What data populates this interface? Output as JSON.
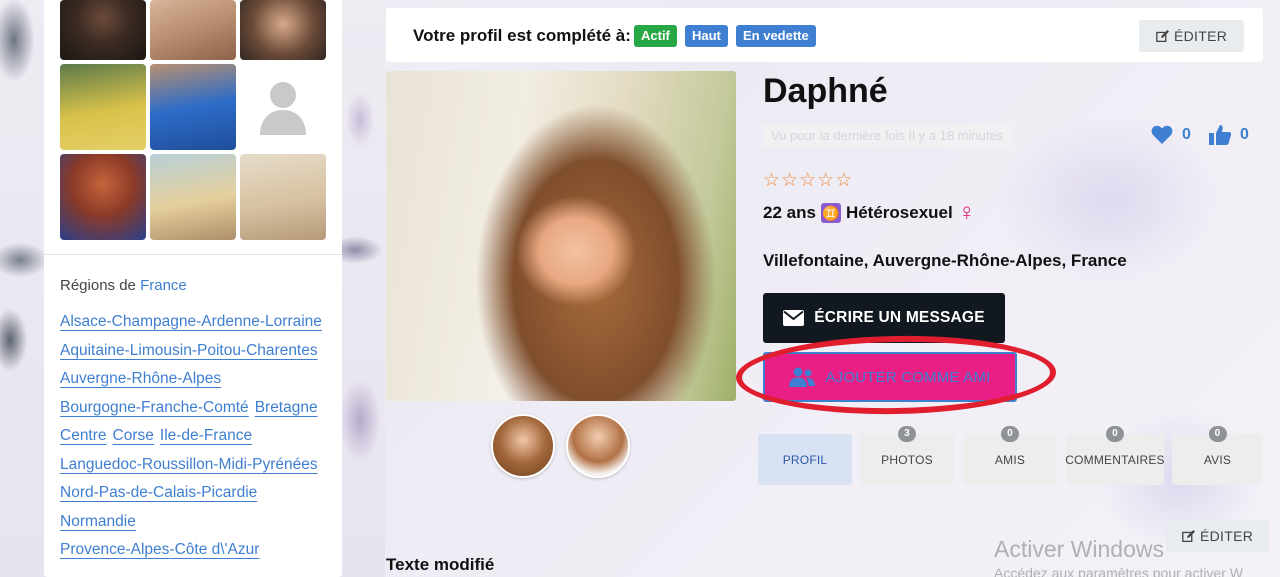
{
  "header": {
    "completion_label": "Votre profil est complété à:",
    "badges": [
      {
        "label": "Actif",
        "color": "#28a745"
      },
      {
        "label": "Haut",
        "color": "#3f7fd1"
      },
      {
        "label": "En vedette",
        "color": "#3f7fd1"
      }
    ],
    "edit_label": "ÉDITER"
  },
  "sidebar": {
    "regions_title": "Régions de",
    "regions_country": "France",
    "regions": [
      "Alsace-Champagne-Ardenne-Lorraine",
      "Aquitaine-Limousin-Poitou-Charentes",
      "Auvergne-Rhône-Alpes",
      "Bourgogne-Franche-Comté",
      "Bretagne",
      "Centre",
      "Corse",
      "Ile-de-France",
      "Languedoc-Roussillon-Midi-Pyrénées",
      "Nord-Pas-de-Calais-Picardie",
      "Normandie",
      "Provence-Alpes-Côte d\\'Azur"
    ]
  },
  "profile": {
    "name": "Daphné",
    "last_seen": "Vu pour la dernière fois Il y a 18 minutes",
    "likes_count": "0",
    "thumbs_count": "0",
    "rating": 0,
    "age": "22 ans",
    "zodiac_glyph": "♊",
    "orientation": "Hétérosexuel",
    "gender_glyph": "♀",
    "location": "Villefontaine, Auvergne-Rhône-Alpes, France"
  },
  "actions": {
    "message_label": "ÉCRIRE UN MESSAGE",
    "add_friend_label": "AJOUTER COMME AMI"
  },
  "tabs": [
    {
      "label": "PROFIL",
      "count": ""
    },
    {
      "label": "PHOTOS",
      "count": "3"
    },
    {
      "label": "AMIS",
      "count": "0"
    },
    {
      "label": "COMMENTAIRES",
      "count": "0"
    },
    {
      "label": "AVIS",
      "count": "0"
    }
  ],
  "section": {
    "edit_label": "ÉDITER",
    "title": "Texte modifié"
  },
  "watermark": {
    "title": "Activer Windows",
    "subtitle": "Accédez aux paramètres pour activer W"
  },
  "colors": {
    "accent": "#3f7fd1",
    "pink": "#ea1f86",
    "dark": "#111820",
    "annotation": "#e11e2e"
  }
}
